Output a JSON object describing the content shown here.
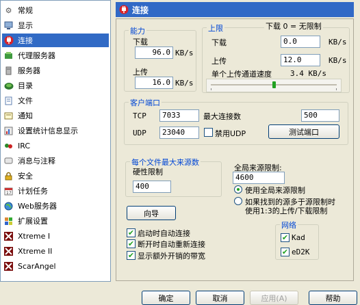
{
  "sidebar": {
    "items": [
      {
        "label": "常规",
        "icon": "gear-icon"
      },
      {
        "label": "显示",
        "icon": "monitor-icon"
      },
      {
        "label": "连接",
        "icon": "connection-plug-icon",
        "selected": true
      },
      {
        "label": "代理服务器",
        "icon": "proxy-icon"
      },
      {
        "label": "服务器",
        "icon": "server-icon"
      },
      {
        "label": "目录",
        "icon": "folder-icon"
      },
      {
        "label": "文件",
        "icon": "file-icon"
      },
      {
        "label": "通知",
        "icon": "notification-icon"
      },
      {
        "label": "设置统计信息显示",
        "icon": "statistics-icon"
      },
      {
        "label": "IRC",
        "icon": "irc-icon"
      },
      {
        "label": "消息与注释",
        "icon": "messages-icon"
      },
      {
        "label": "安全",
        "icon": "lock-icon"
      },
      {
        "label": "计划任务",
        "icon": "calendar-icon"
      },
      {
        "label": "Web服务器",
        "icon": "globe-icon"
      },
      {
        "label": "扩展设置",
        "icon": "puzzle-icon"
      },
      {
        "label": "Xtreme I",
        "icon": "xtreme-icon"
      },
      {
        "label": "Xtreme II",
        "icon": "xtreme-icon"
      },
      {
        "label": "ScarAngel",
        "icon": "xtreme-icon"
      }
    ]
  },
  "header": {
    "title": "连接",
    "icon": "connection-plug-icon"
  },
  "capacity": {
    "title": "能力",
    "download_label": "下载",
    "download_value": "96.0",
    "upload_label": "上传",
    "upload_value": "16.0",
    "unit": "KB/s"
  },
  "limits": {
    "title": "上限",
    "note": "下载 0 = 无限制",
    "download_label": "下载",
    "download_value": "0.0",
    "upload_label": "上传",
    "upload_value": "12.0",
    "unit": "KB/s",
    "slot_speed_label": "单个上传通道速度",
    "slot_speed_value": "3.4 KB/s",
    "slider_fraction": 0.5
  },
  "client_port": {
    "title": "客户端口",
    "tcp_label": "TCP",
    "tcp_value": "7033",
    "udp_label": "UDP",
    "udp_value": "23040",
    "max_conn_label": "最大连接数",
    "max_conn_value": "500",
    "disable_udp_label": "禁用UDP",
    "disable_udp_checked": false,
    "test_button": "测试端口"
  },
  "max_sources": {
    "title": "每个文件最大来源数",
    "hard_limit_label": "硬性限制",
    "hard_limit_value": "400"
  },
  "global_sources": {
    "label": "全局来源限制:",
    "value": "4600",
    "opt1_label": "使用全局来源限制",
    "opt2_line1": "如果找到的源多于源限制时",
    "opt2_line2": "使用1:3的上传/下载限制",
    "selected": "opt1"
  },
  "wizard_button": "向导",
  "checks": [
    {
      "label": "启动时自动连接",
      "checked": true
    },
    {
      "label": "断开时自动重新连接",
      "checked": true
    },
    {
      "label": "显示额外开销的带宽",
      "checked": true
    }
  ],
  "network": {
    "title": "网络",
    "kad_label": "Kad",
    "kad_checked": true,
    "ed2k_label": "eD2K",
    "ed2k_checked": true
  },
  "footer": {
    "ok": "确定",
    "cancel": "取消",
    "apply": "应用(A)",
    "help": "帮助"
  },
  "colors": {
    "selection": "#316ac5",
    "header_bg": "#3169c6",
    "group_title": "#0046d5",
    "check_mark": "#21a121"
  }
}
